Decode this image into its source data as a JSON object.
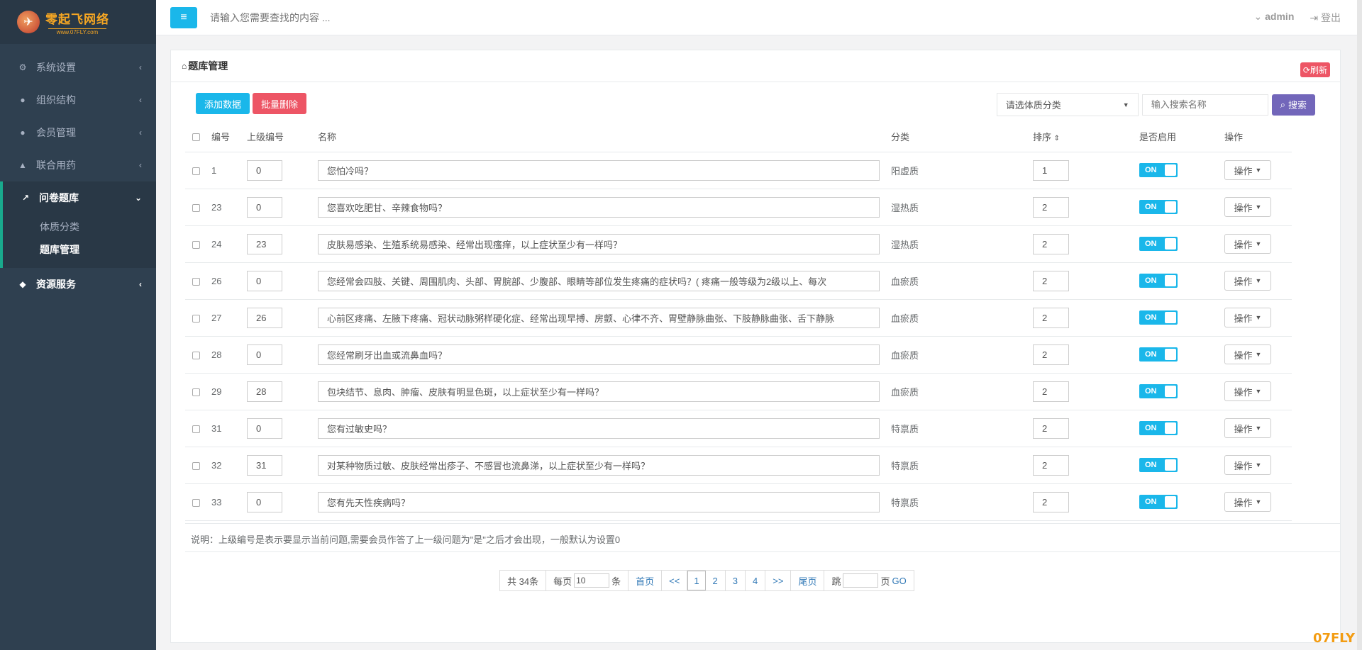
{
  "logo": {
    "title": "零起飞网络",
    "subtitle": "www.07FLY.com"
  },
  "sidebar": {
    "items": [
      {
        "label": "系统设置",
        "icon": "cogs-icon"
      },
      {
        "label": "组织结构",
        "icon": "user-icon"
      },
      {
        "label": "会员管理",
        "icon": "users-icon"
      },
      {
        "label": "联合用药",
        "icon": "bank-icon"
      }
    ],
    "active_group": {
      "label": "问卷题库",
      "icon": "line-chart-icon",
      "sub": [
        "体质分类",
        "题库管理"
      ]
    },
    "last_item": {
      "label": "资源服务",
      "icon": "cube-icon"
    }
  },
  "topbar": {
    "search_placeholder": "请输入您需要查找的内容 ...",
    "user": "admin",
    "logout": "登出"
  },
  "panel": {
    "title": "题库管理",
    "refresh": "刷新"
  },
  "toolbar": {
    "add": "添加数据",
    "batch_delete": "批量删除"
  },
  "filter": {
    "select_value": "请选体质分类",
    "search_placeholder": "输入搜索名称",
    "search_btn": "搜索"
  },
  "table": {
    "headers": [
      "编号",
      "上级编号",
      "名称",
      "分类",
      "排序",
      "是否启用",
      "操作"
    ],
    "rows": [
      {
        "id": "1",
        "parent": "0",
        "name": "您怕冷吗？",
        "category": "阳虚质",
        "sort": "1",
        "enabled": "ON",
        "op": "操作"
      },
      {
        "id": "23",
        "parent": "0",
        "name": "您喜欢吃肥甘、辛辣食物吗？",
        "category": "湿热质",
        "sort": "2",
        "enabled": "ON",
        "op": "操作"
      },
      {
        "id": "24",
        "parent": "23",
        "name": "皮肤易感染、生殖系统易感染、经常出现瘙痒，以上症状至少有一样吗？",
        "category": "湿热质",
        "sort": "2",
        "enabled": "ON",
        "op": "操作"
      },
      {
        "id": "26",
        "parent": "0",
        "name": "您经常会四肢、关键、周围肌肉、头部、胃脘部、少腹部、眼睛等部位发生疼痛的症状吗？( 疼痛一般等级为2级以上、每次",
        "category": "血瘀质",
        "sort": "2",
        "enabled": "ON",
        "op": "操作"
      },
      {
        "id": "27",
        "parent": "26",
        "name": "心前区疼痛、左腋下疼痛、冠状动脉粥样硬化症、经常出现早搏、房颤、心律不齐、胃壁静脉曲张、下肢静脉曲张、舌下静脉",
        "category": "血瘀质",
        "sort": "2",
        "enabled": "ON",
        "op": "操作"
      },
      {
        "id": "28",
        "parent": "0",
        "name": "您经常刷牙出血或流鼻血吗？",
        "category": "血瘀质",
        "sort": "2",
        "enabled": "ON",
        "op": "操作"
      },
      {
        "id": "29",
        "parent": "28",
        "name": "包块结节、息肉、肿瘤、皮肤有明显色斑，以上症状至少有一样吗？",
        "category": "血瘀质",
        "sort": "2",
        "enabled": "ON",
        "op": "操作"
      },
      {
        "id": "31",
        "parent": "0",
        "name": "您有过敏史吗？",
        "category": "特禀质",
        "sort": "2",
        "enabled": "ON",
        "op": "操作"
      },
      {
        "id": "32",
        "parent": "31",
        "name": "对某种物质过敏、皮肤经常出疹子、不感冒也流鼻涕，以上症状至少有一样吗？",
        "category": "特禀质",
        "sort": "2",
        "enabled": "ON",
        "op": "操作"
      },
      {
        "id": "33",
        "parent": "0",
        "name": "您有先天性疾病吗？",
        "category": "特禀质",
        "sort": "2",
        "enabled": "ON",
        "op": "操作"
      }
    ]
  },
  "note": "说明：上级编号是表示要显示当前问题,需要会员作答了上一级问题为\"是\"之后才会出现，一般默认为设置0",
  "pager": {
    "total": "共 34条",
    "per_page_prefix": "每页",
    "per_page_value": "10",
    "per_page_suffix": "条",
    "first": "首页",
    "prev": "<<",
    "pages": [
      "1",
      "2",
      "3",
      "4"
    ],
    "current": "1",
    "next": ">>",
    "last": "尾页",
    "jump_prefix": "跳",
    "jump_suffix": "页",
    "go": "GO"
  },
  "watermark": "07FLY"
}
